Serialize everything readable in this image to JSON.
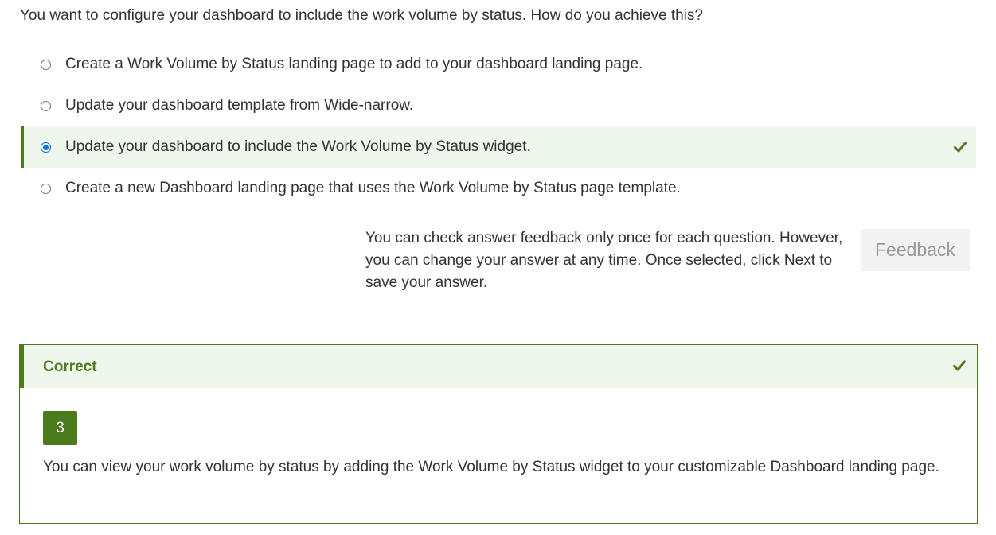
{
  "question": "You want to configure your dashboard to include the work volume by status. How do you achieve this?",
  "options": [
    {
      "label": "Create a Work Volume by Status landing page to add to your dashboard landing page.",
      "selected": false
    },
    {
      "label": "Update your dashboard template from Wide-narrow.",
      "selected": false
    },
    {
      "label": "Update your dashboard to include the Work Volume by Status widget.",
      "selected": true,
      "correct": true
    },
    {
      "label": "Create a new Dashboard landing page that uses the Work Volume by Status page template.",
      "selected": false
    }
  ],
  "info_text": "You can check answer feedback only once for each question. However, you can change your answer at any time. Once selected, click Next to save your answer.",
  "feedback_button_label": "Feedback",
  "feedback_panel": {
    "title": "Correct",
    "answer_number": "3",
    "explanation": "You can view your work volume by status by adding the Work Volume by Status widget to your customizable Dashboard landing page."
  },
  "colors": {
    "accent_green": "#4a7b1c",
    "selected_bg": "#eff7ec",
    "radio_blue": "#0075ff"
  },
  "icons": {
    "correct": "check-icon"
  }
}
